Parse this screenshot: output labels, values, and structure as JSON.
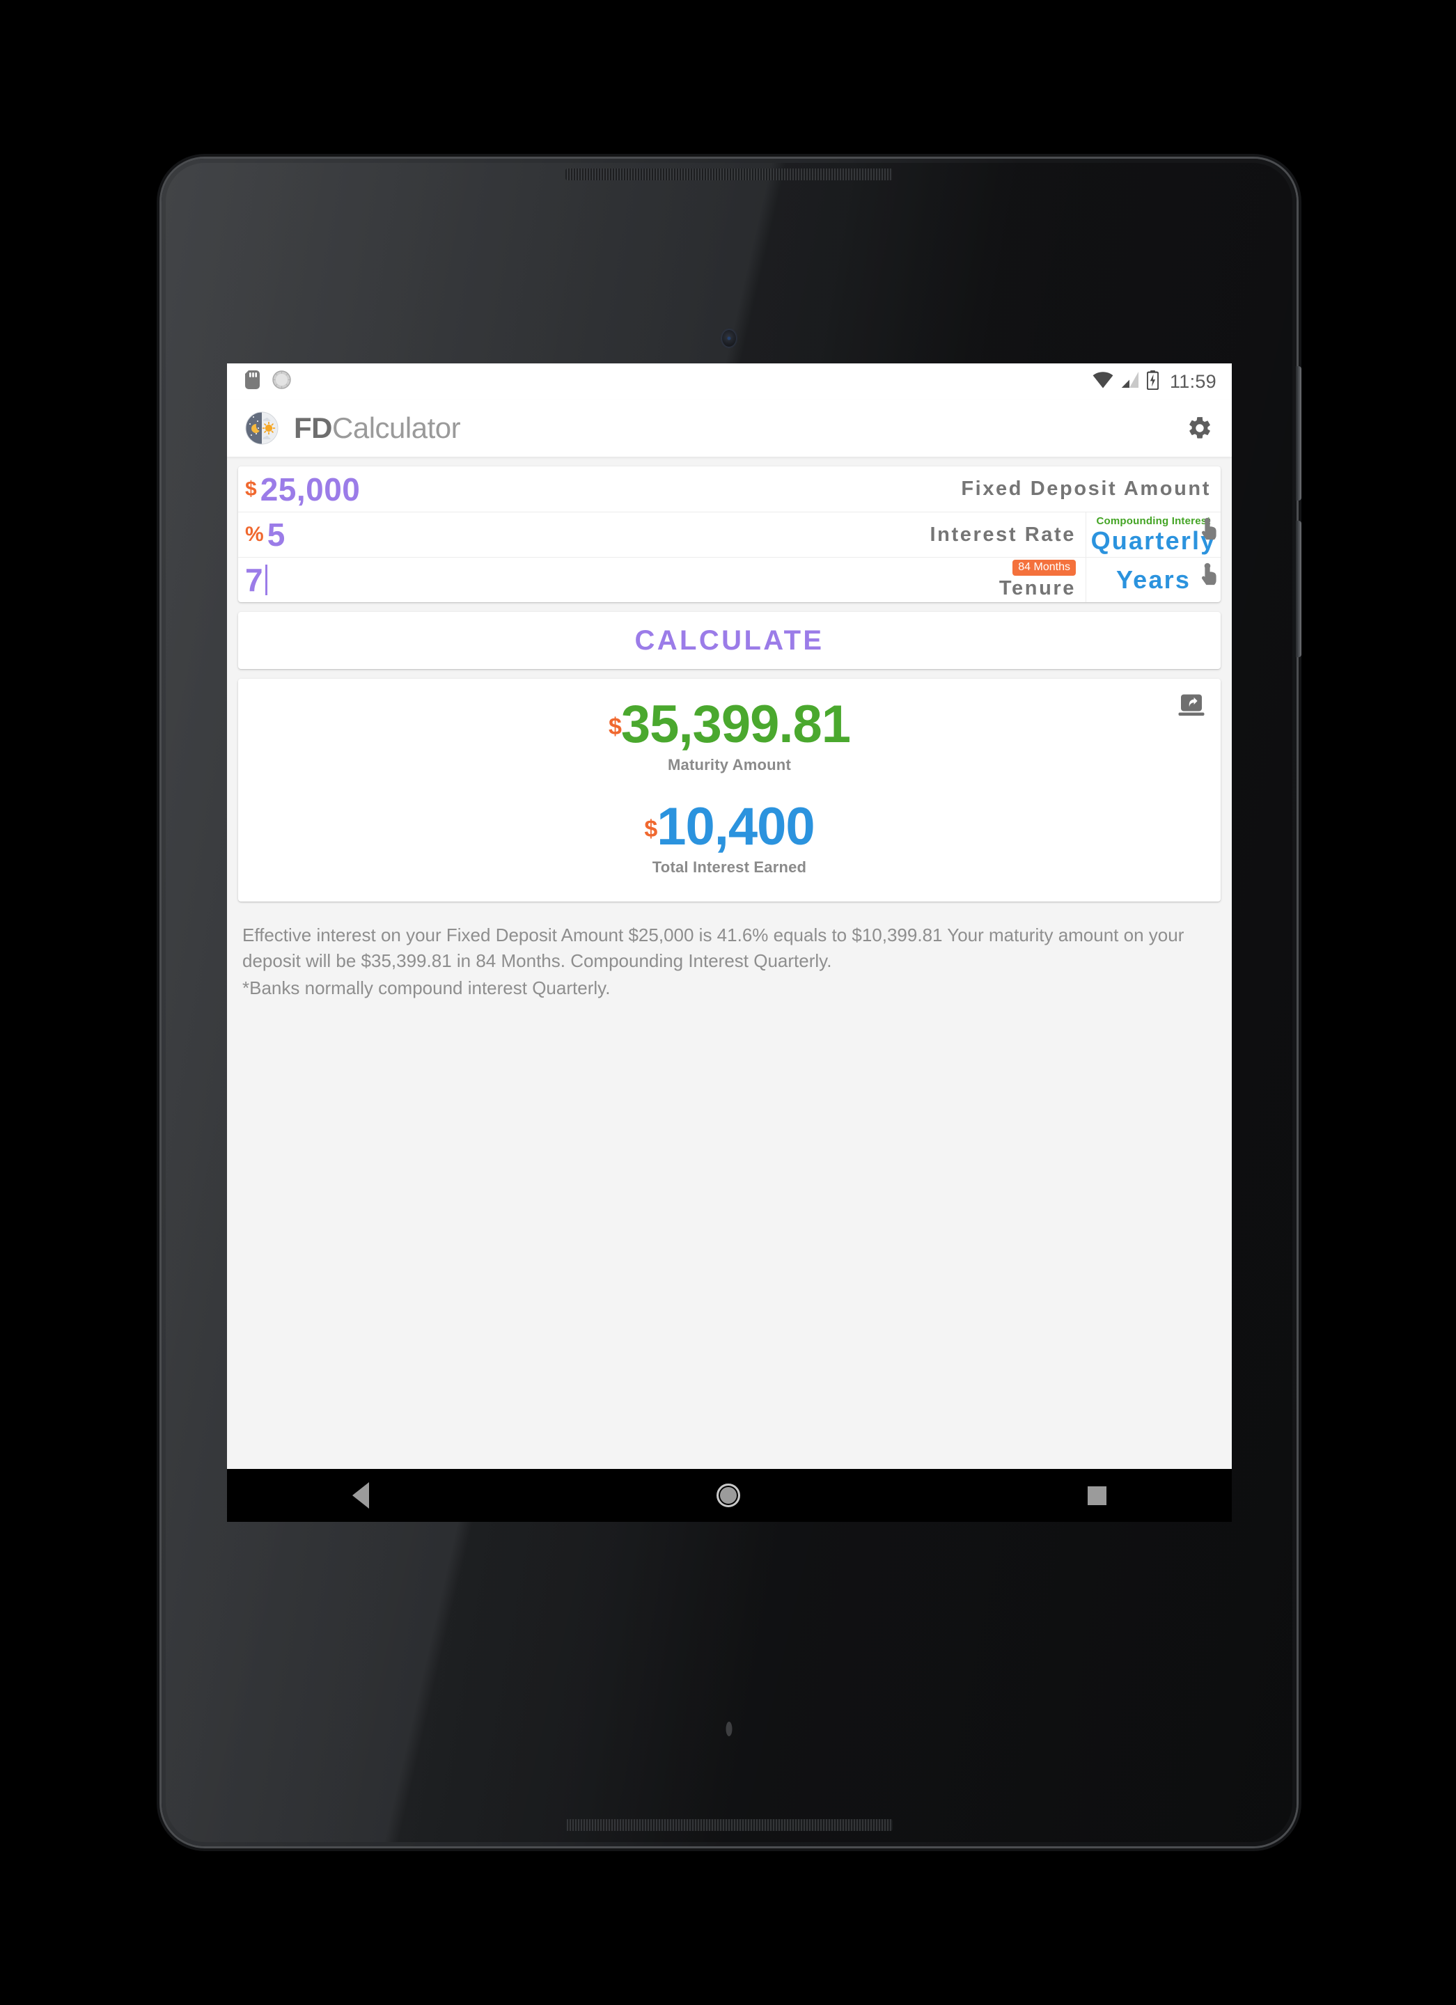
{
  "status_bar": {
    "time": "11:59",
    "left_icons": [
      "sd-card-icon",
      "alarm-clock-icon"
    ],
    "right_icons": [
      "wifi-icon",
      "cellular-signal-icon",
      "battery-charging-icon"
    ]
  },
  "app_bar": {
    "icon": "day-night-app-icon",
    "title_bold": "FD",
    "title_light": "Calculator",
    "settings_icon": "gear-icon"
  },
  "inputs": {
    "deposit": {
      "prefix": "$",
      "value": "25,000",
      "label": "Fixed Deposit Amount"
    },
    "rate": {
      "prefix": "%",
      "value": "5",
      "label": "Interest Rate",
      "select_caption": "Compounding Interest",
      "select_value": "Quarterly",
      "tap_icon": "tap-gesture-icon"
    },
    "tenure": {
      "prefix": "",
      "value": "7",
      "label": "Tenure",
      "badge": "84 Months",
      "select_value": "Years",
      "tap_icon": "tap-gesture-icon"
    }
  },
  "calculate": {
    "label": "CALCULATE"
  },
  "results": {
    "share_icon": "share-icon",
    "maturity": {
      "currency": "$",
      "amount": "35,399.81",
      "caption": "Maturity Amount"
    },
    "interest": {
      "currency": "$",
      "amount": "10,400",
      "caption": "Total Interest Earned"
    }
  },
  "explanation": {
    "paragraph": "Effective interest on your Fixed Deposit Amount $25,000 is 41.6% equals to $10,399.81 Your maturity amount on your deposit will be $35,399.81 in 84 Months. Compounding Interest Quarterly.",
    "note": "*Banks normally compound interest Quarterly."
  },
  "nav_bar": {
    "back": "back-nav-icon",
    "home": "home-nav-icon",
    "recents": "recents-nav-icon"
  },
  "colors": {
    "accent_purple": "#9b7ce8",
    "accent_orange": "#f0682f",
    "accent_blue": "#2b93de",
    "accent_green": "#4aa82e",
    "badge_orange": "#f4713c",
    "label_gray": "#757575"
  }
}
